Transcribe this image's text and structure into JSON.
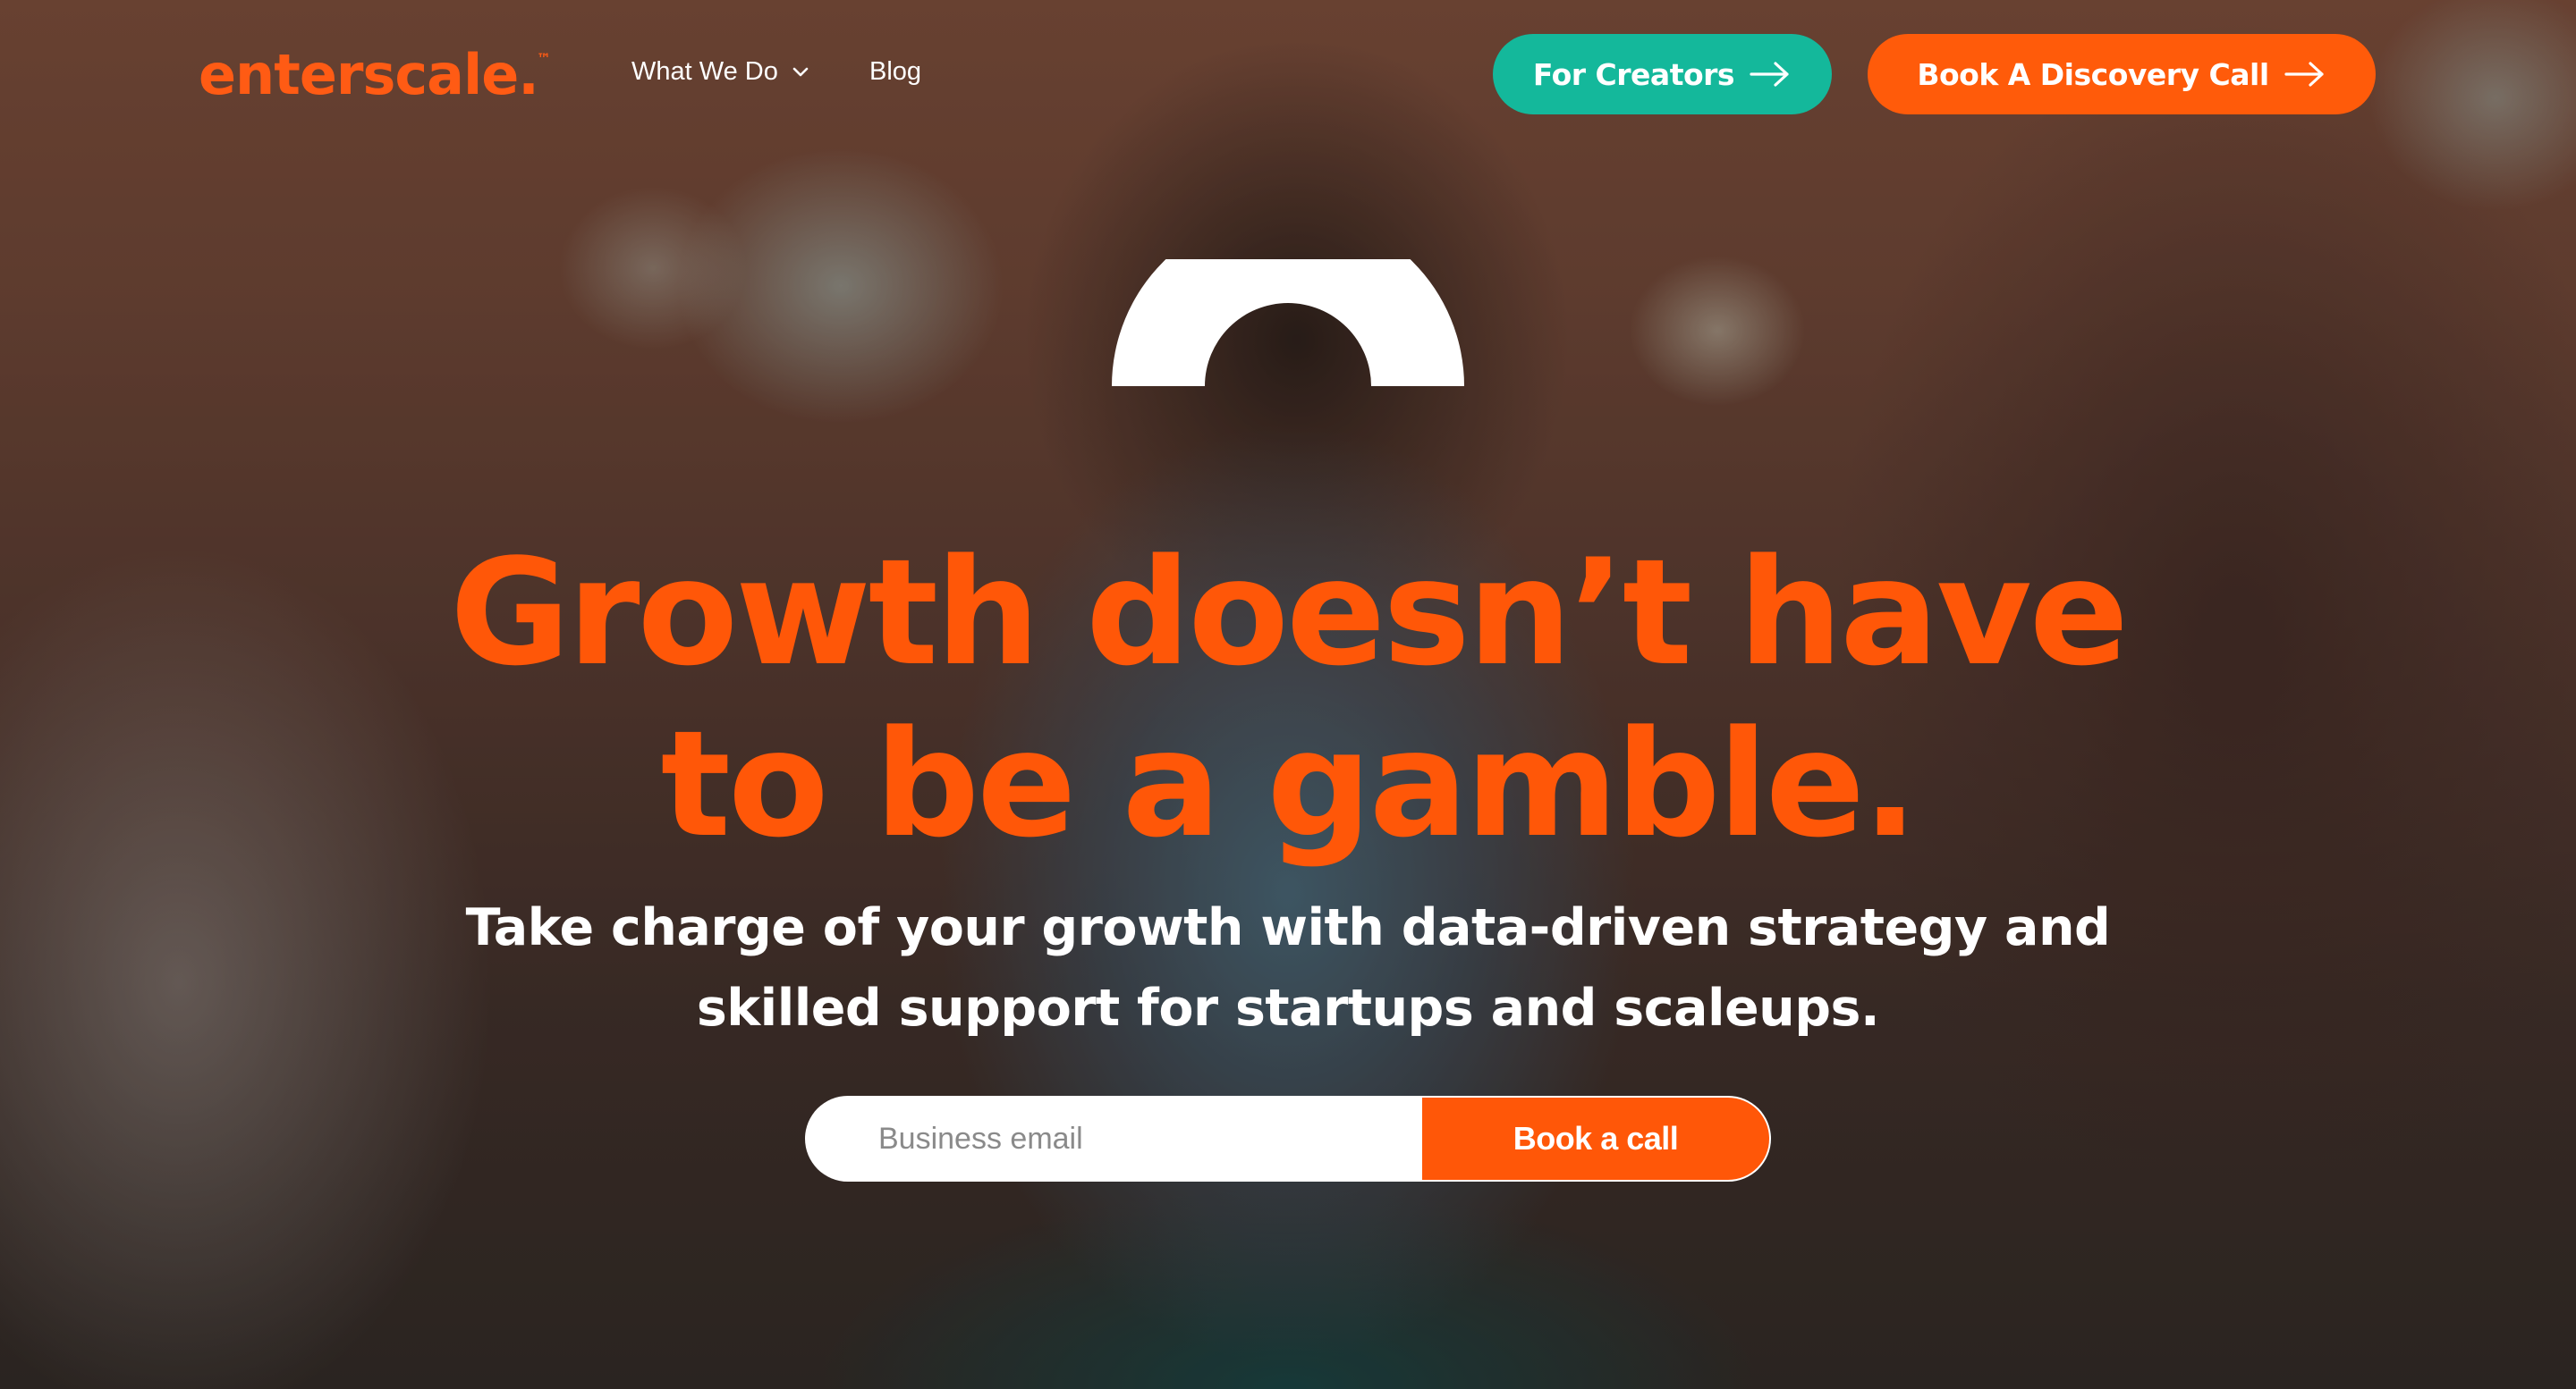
{
  "colors": {
    "brand_orange": "#ff5708",
    "creators_teal": "#14b89b",
    "white": "#ffffff"
  },
  "nav": {
    "logo_text": "enterscale.",
    "logo_mark": "™",
    "links": [
      {
        "label": "What We Do",
        "icon": "chevron-down-icon"
      },
      {
        "label": "Blog"
      }
    ],
    "cta_creators": {
      "label": "For Creators",
      "icon": "arrow-right-icon"
    },
    "cta_discovery": {
      "label": "Book A Discovery Call",
      "icon": "arrow-right-icon"
    }
  },
  "hero": {
    "headline": [
      "Growth doesn’t have",
      "to be a gamble."
    ],
    "subheadline": [
      "Take charge of your growth with data-driven strategy and",
      "skilled support for startups and scaleups."
    ],
    "email_placeholder": "Business email",
    "submit_label": "Book a call"
  }
}
